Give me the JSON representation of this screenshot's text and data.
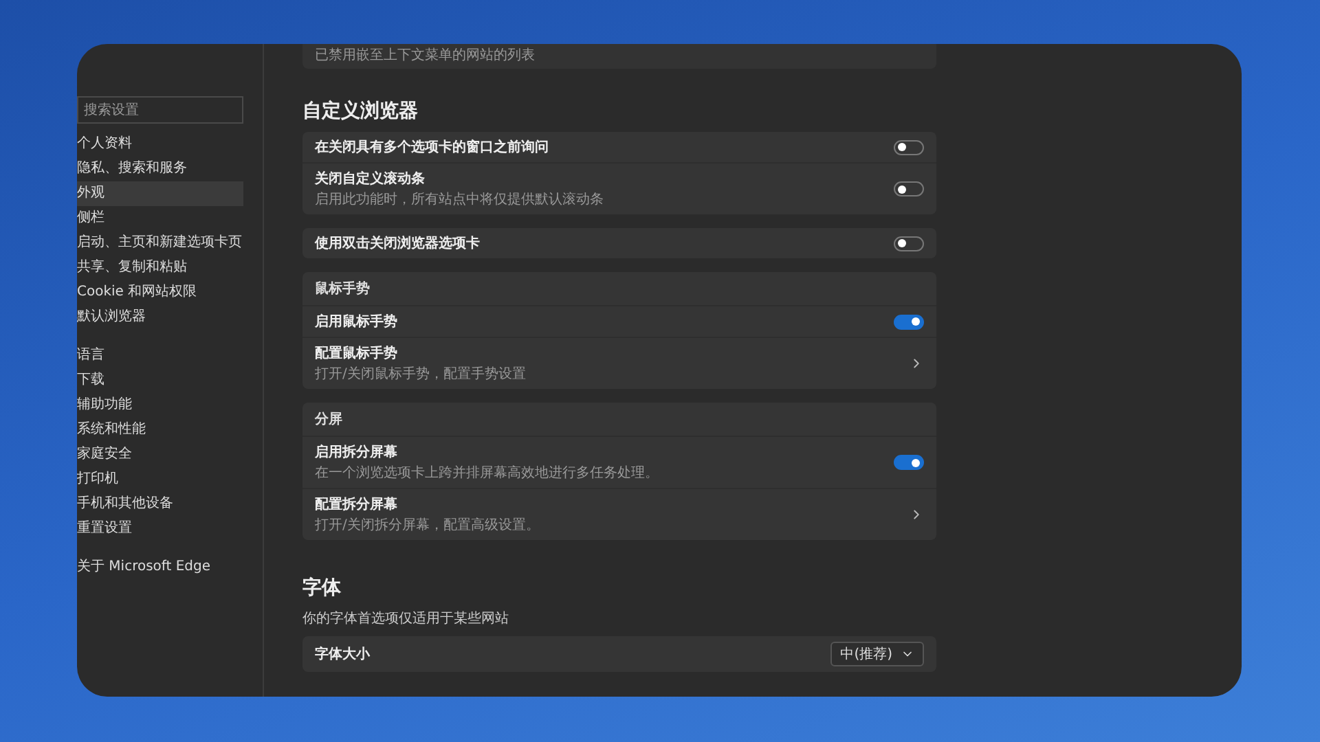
{
  "sidebar": {
    "search": {
      "placeholder": "搜索设置"
    },
    "groups": [
      [
        {
          "label": "个人资料",
          "selected": false
        },
        {
          "label": "隐私、搜索和服务",
          "selected": false
        },
        {
          "label": "外观",
          "selected": true
        },
        {
          "label": "侧栏",
          "selected": false
        },
        {
          "label": "启动、主页和新建选项卡页",
          "selected": false
        },
        {
          "label": "共享、复制和粘贴",
          "selected": false
        },
        {
          "label": "Cookie 和网站权限",
          "selected": false
        },
        {
          "label": "默认浏览器",
          "selected": false
        }
      ],
      [
        {
          "label": "语言",
          "selected": false
        },
        {
          "label": "下载",
          "selected": false
        },
        {
          "label": "辅助功能",
          "selected": false
        },
        {
          "label": "系统和性能",
          "selected": false
        },
        {
          "label": "家庭安全",
          "selected": false
        },
        {
          "label": "打印机",
          "selected": false
        },
        {
          "label": "手机和其他设备",
          "selected": false
        },
        {
          "label": "重置设置",
          "selected": false
        }
      ],
      [
        {
          "label": "关于 Microsoft Edge",
          "selected": false
        }
      ]
    ]
  },
  "top_card": {
    "description": "已禁用嵌至上下文菜单的网站的列表"
  },
  "sections": [
    {
      "title": "自定义浏览器",
      "cards": [
        {
          "rows": [
            {
              "kind": "toggle",
              "label": "在关闭具有多个选项卡的窗口之前询问",
              "on": false
            },
            {
              "kind": "toggle",
              "label": "关闭自定义滚动条",
              "description": "启用此功能时，所有站点中将仅提供默认滚动条",
              "on": false
            }
          ]
        },
        {
          "rows": [
            {
              "kind": "toggle",
              "label": "使用双击关闭浏览器选项卡",
              "on": false
            }
          ]
        },
        {
          "header": "鼠标手势",
          "rows": [
            {
              "kind": "toggle",
              "label": "启用鼠标手势",
              "on": true
            },
            {
              "kind": "link",
              "label": "配置鼠标手势",
              "description": "打开/关闭鼠标手势，配置手势设置"
            }
          ]
        },
        {
          "header": "分屏",
          "rows": [
            {
              "kind": "toggle",
              "label": "启用拆分屏幕",
              "description": "在一个浏览选项卡上跨并排屏幕高效地进行多任务处理。",
              "on": true
            },
            {
              "kind": "link",
              "label": "配置拆分屏幕",
              "description": "打开/关闭拆分屏幕，配置高级设置。"
            }
          ]
        }
      ]
    },
    {
      "title": "字体",
      "subtitle": "你的字体首选项仅适用于某些网站",
      "cards": [
        {
          "rows": [
            {
              "kind": "dropdown",
              "label": "字体大小",
              "value": "中(推荐)"
            }
          ]
        }
      ]
    }
  ]
}
